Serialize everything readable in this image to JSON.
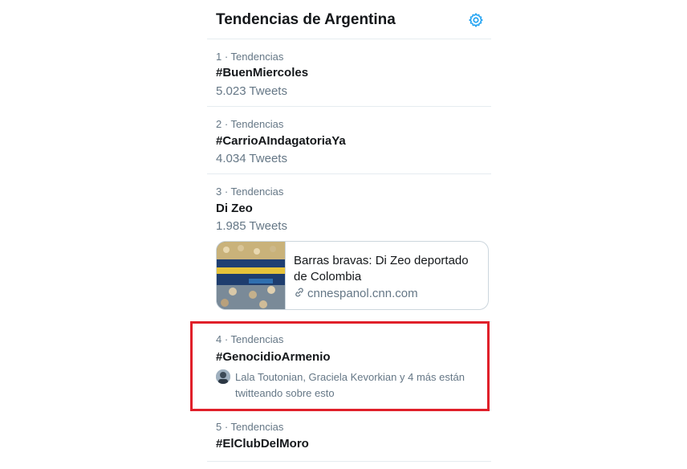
{
  "header": {
    "title": "Tendencias de Argentina",
    "settings_icon": "gear-icon"
  },
  "trends": [
    {
      "meta": "1 · Tendencias",
      "name": "#BuenMiercoles",
      "count": "5.023 Tweets"
    },
    {
      "meta": "2 · Tendencias",
      "name": "#CarrioAIndagatoriaYa",
      "count": "4.034 Tweets"
    },
    {
      "meta": "3 · Tendencias",
      "name": "Di Zeo",
      "count": "1.985 Tweets",
      "card": {
        "headline": "Barras bravas: Di Zeo deportado de Colombia",
        "domain": "cnnespanol.cnn.com",
        "icon": "link-icon"
      }
    },
    {
      "meta": "4 · Tendencias",
      "name": "#GenocidioArmenio",
      "context": "Lala Toutonian, Graciela Kevorkian y 4 más están twitteando sobre esto"
    },
    {
      "meta": "5 · Tendencias",
      "name": "#ElClubDelMoro"
    }
  ],
  "colors": {
    "accent": "#1da1f2",
    "secondary_text": "#657786",
    "highlight_border": "#e0202a"
  }
}
